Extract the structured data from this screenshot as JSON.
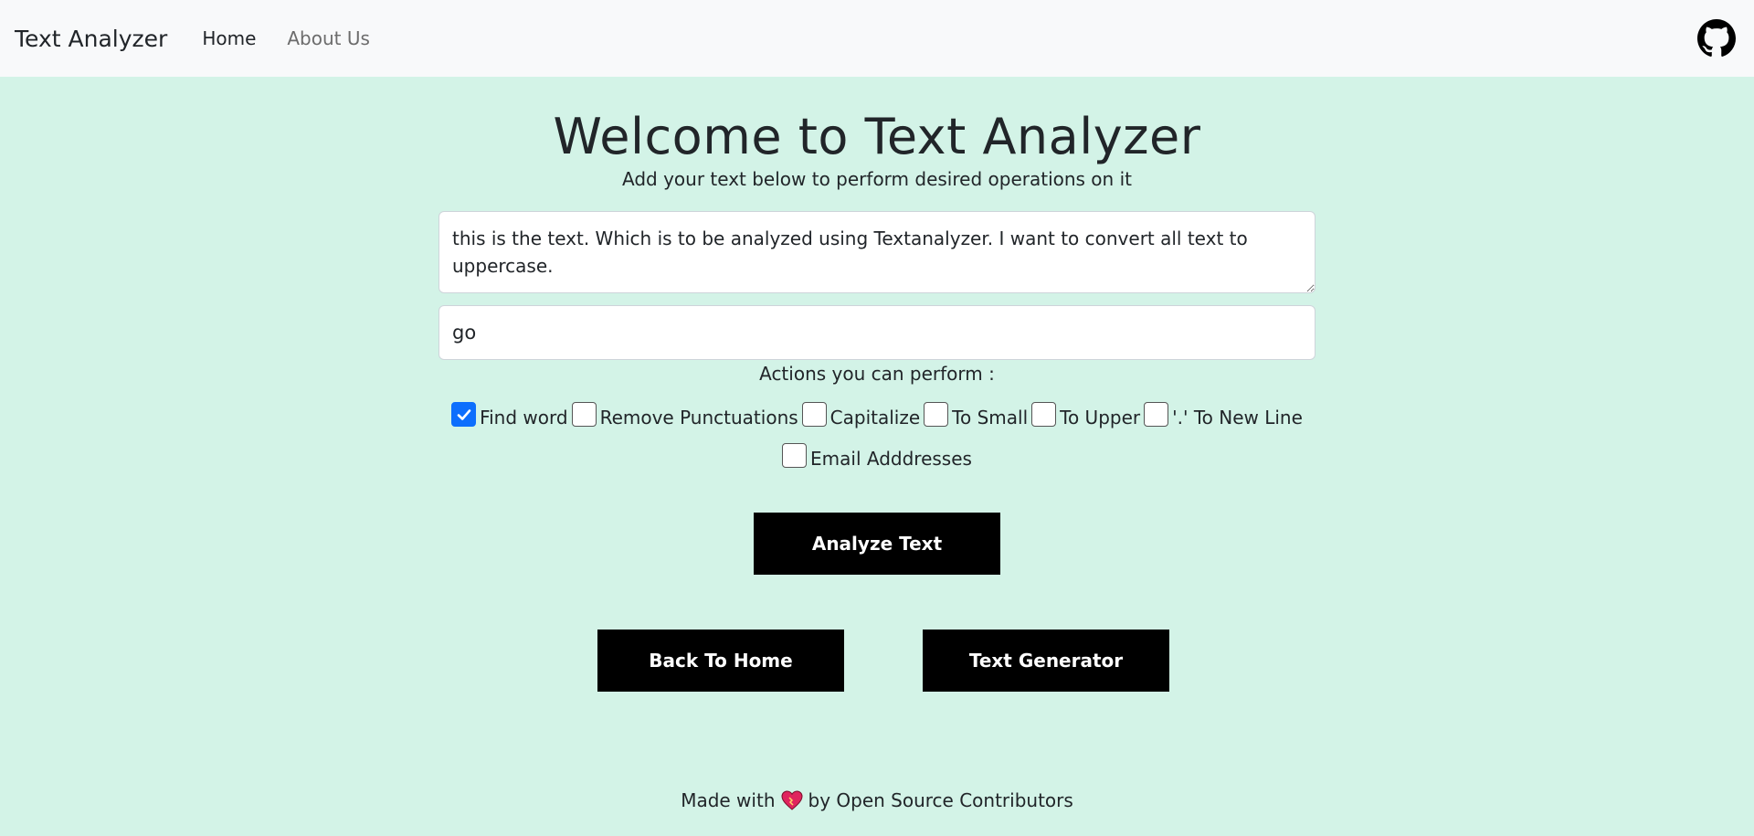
{
  "navbar": {
    "brand": "Text Analyzer",
    "links": [
      {
        "label": "Home",
        "active": true
      },
      {
        "label": "About Us",
        "active": false
      }
    ],
    "github_icon": "github-icon"
  },
  "main": {
    "title": "Welcome to Text Analyzer",
    "subtitle": "Add your text below to perform desired operations on it",
    "textarea_value": "this is the text. Which is to be analyzed using Textanalyzer. I want to convert all text to uppercase.",
    "word_input_value": "go",
    "actions_label": "Actions you can perform :",
    "options": [
      {
        "label": "Find word",
        "checked": true
      },
      {
        "label": "Remove Punctuations",
        "checked": false
      },
      {
        "label": "Capitalize",
        "checked": false
      },
      {
        "label": "To Small",
        "checked": false
      },
      {
        "label": "To Upper",
        "checked": false
      },
      {
        "label": "'.' To New Line",
        "checked": false
      },
      {
        "label": "Email Adddresses",
        "checked": false
      }
    ],
    "analyze_button": "Analyze Text",
    "back_home_button": "Back To Home",
    "text_generator_button": "Text Generator"
  },
  "footer": {
    "made_with": "Made with",
    "by": "by Open Source Contributors",
    "heart_icon": "heart-icon"
  },
  "colors": {
    "background": "#d3f3e7",
    "navbar": "#f8f9fa",
    "button": "#000000",
    "checkbox_checked": "#0d6efd"
  }
}
